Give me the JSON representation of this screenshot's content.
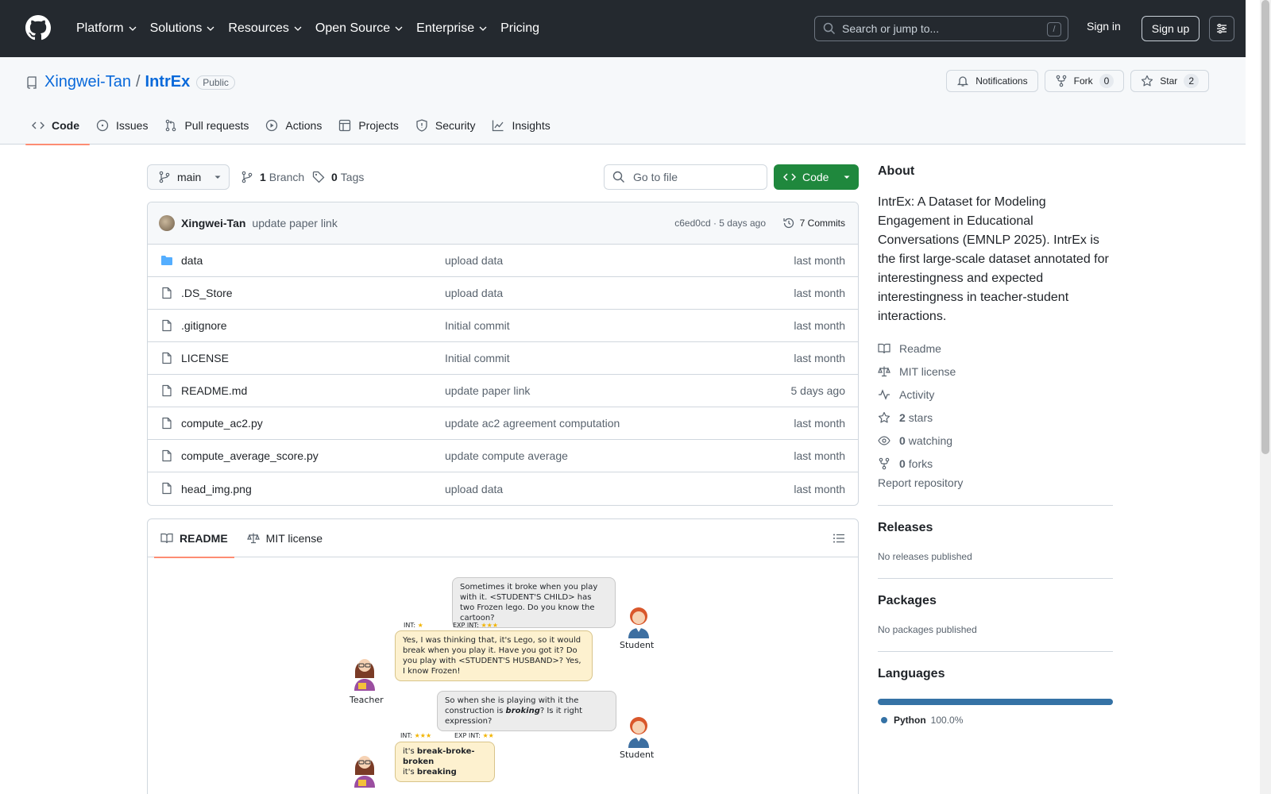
{
  "header": {
    "nav": [
      "Platform",
      "Solutions",
      "Resources",
      "Open Source",
      "Enterprise",
      "Pricing"
    ],
    "search_placeholder": "Search or jump to...",
    "search_shortcut": "/",
    "signin": "Sign in",
    "signup": "Sign up"
  },
  "repo": {
    "owner": "Xingwei-Tan",
    "name": "IntrEx",
    "visibility": "Public",
    "notifications_label": "Notifications",
    "fork_label": "Fork",
    "fork_count": "0",
    "star_label": "Star",
    "star_count": "2",
    "tabs": [
      "Code",
      "Issues",
      "Pull requests",
      "Actions",
      "Projects",
      "Security",
      "Insights"
    ]
  },
  "filenav": {
    "branch": "main",
    "branch_count": "1",
    "branch_label": "Branch",
    "tag_count": "0",
    "tag_label": "Tags",
    "goto_placeholder": "Go to file",
    "code_button": "Code"
  },
  "commit": {
    "author": "Xingwei-Tan",
    "message": "update paper link",
    "sha_time": "c6ed0cd · 5 days ago",
    "commits_label": "7 Commits"
  },
  "files": [
    {
      "name": "data",
      "type": "folder",
      "message": "upload data",
      "age": "last month"
    },
    {
      "name": ".DS_Store",
      "type": "file",
      "message": "upload data",
      "age": "last month"
    },
    {
      "name": ".gitignore",
      "type": "file",
      "message": "Initial commit",
      "age": "last month"
    },
    {
      "name": "LICENSE",
      "type": "file",
      "message": "Initial commit",
      "age": "last month"
    },
    {
      "name": "README.md",
      "type": "file",
      "message": "update paper link",
      "age": "5 days ago"
    },
    {
      "name": "compute_ac2.py",
      "type": "file",
      "message": "update ac2 agreement computation",
      "age": "last month"
    },
    {
      "name": "compute_average_score.py",
      "type": "file",
      "message": "update compute average",
      "age": "last month"
    },
    {
      "name": "head_img.png",
      "type": "file",
      "message": "upload data",
      "age": "last month"
    }
  ],
  "readme": {
    "tab_readme": "README",
    "tab_license": "MIT license",
    "illustration": {
      "bubble1": "Sometimes it broke when you play with it. <STUDENT'S CHILD> has two Frozen lego. Do you know the cartoon?",
      "rating1_int": "INT:",
      "rating1_exp": "EXP INT:",
      "bubble2": "Yes, I was thinking that, it's Lego, so it would break when you play it. Have you got it?  Do you play with <STUDENT'S HUSBAND>?  Yes, I know Frozen!",
      "bubble3_pre": "So when she is playing with it the construction is ",
      "bubble3_em": "broking",
      "bubble3_post": "? Is it right expression?",
      "rating2_int": "INT:",
      "rating2_exp": "EXP INT:",
      "bubble4_a_pre": "it's ",
      "bubble4_a_bold": "break-broke-broken",
      "bubble4_b_pre": "it's ",
      "bubble4_b_bold": "breaking",
      "student_label": "Student",
      "teacher_label": "Teacher"
    }
  },
  "sidebar": {
    "about_title": "About",
    "description": "IntrEx: A Dataset for Modeling Engagement in Educational Conversations (EMNLP 2025). IntrEx is the first large-scale dataset annotated for interestingness and expected interestingness in teacher-student interactions.",
    "readme": "Readme",
    "license": "MIT license",
    "activity": "Activity",
    "stars_count": "2",
    "stars_label": "stars",
    "watching_count": "0",
    "watching_label": "watching",
    "forks_count": "0",
    "forks_label": "forks",
    "report": "Report repository",
    "releases_title": "Releases",
    "releases_sub": "No releases published",
    "packages_title": "Packages",
    "packages_sub": "No packages published",
    "languages_title": "Languages",
    "language_name": "Python",
    "language_pct": "100.0%"
  },
  "colors": {
    "header_bg": "#24292f",
    "accent_link": "#0969da",
    "code_button": "#1f883d",
    "tab_underline": "#fd8c73",
    "python": "#3572A5"
  }
}
